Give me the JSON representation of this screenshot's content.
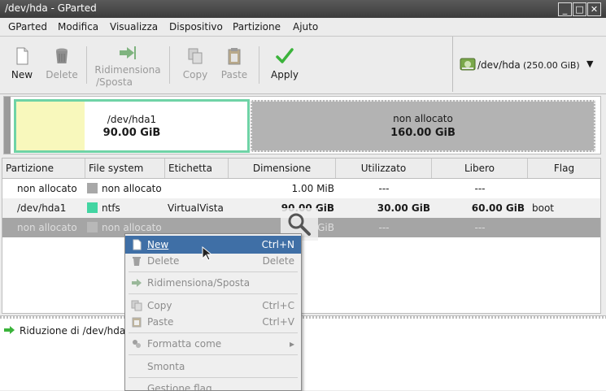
{
  "window": {
    "title": "/dev/hda - GParted"
  },
  "menu": [
    "GParted",
    "Modifica",
    "Visualizza",
    "Dispositivo",
    "Partizione",
    "Ajuto"
  ],
  "toolbar": {
    "new": "New",
    "delete": "Delete",
    "resize_line1": "Ridimensiona",
    "resize_line2": "/Sposta",
    "copy": "Copy",
    "paste": "Paste",
    "apply": "Apply"
  },
  "device": {
    "path": "/dev/hda",
    "size": "(250.00 GiB)"
  },
  "graphic": {
    "p1_name": "/dev/hda1",
    "p1_size": "90.00 GiB",
    "p2_name": "non allocato",
    "p2_size": "160.00 GiB"
  },
  "columns": [
    "Partizione",
    "File system",
    "Etichetta",
    "Dimensione",
    "Utilizzato",
    "Libero",
    "Flag"
  ],
  "rows": [
    {
      "partition": "non allocato",
      "fs": "non allocato",
      "label": "",
      "size": "1.00 MiB",
      "used": "---",
      "free": "---",
      "flag": ""
    },
    {
      "partition": "/dev/hda1",
      "fs": "ntfs",
      "label": "VirtualVista",
      "size": "90.00 GiB",
      "used": "30.00 GiB",
      "free": "60.00 GiB",
      "flag": "boot"
    },
    {
      "partition": "non allocato",
      "fs": "non allocato",
      "label": "",
      "size": "GiB",
      "used": "---",
      "free": "---",
      "flag": ""
    }
  ],
  "colors": {
    "ntfs": "#42d5a2",
    "unallocated": "#a8a8a8",
    "selection": "#3f6fa6",
    "apply_green": "#3bb33b"
  },
  "status": {
    "operation": "Riduzione di /dev/hda"
  },
  "context_menu": {
    "new": "New",
    "new_acc": "Ctrl+N",
    "delete": "Delete",
    "delete_acc": "Delete",
    "resize": "Ridimensiona/Sposta",
    "copy": "Copy",
    "copy_acc": "Ctrl+C",
    "paste": "Paste",
    "paste_acc": "Ctrl+V",
    "format": "Formatta come",
    "unmount": "Smonta",
    "flags": "Gestione flag"
  }
}
